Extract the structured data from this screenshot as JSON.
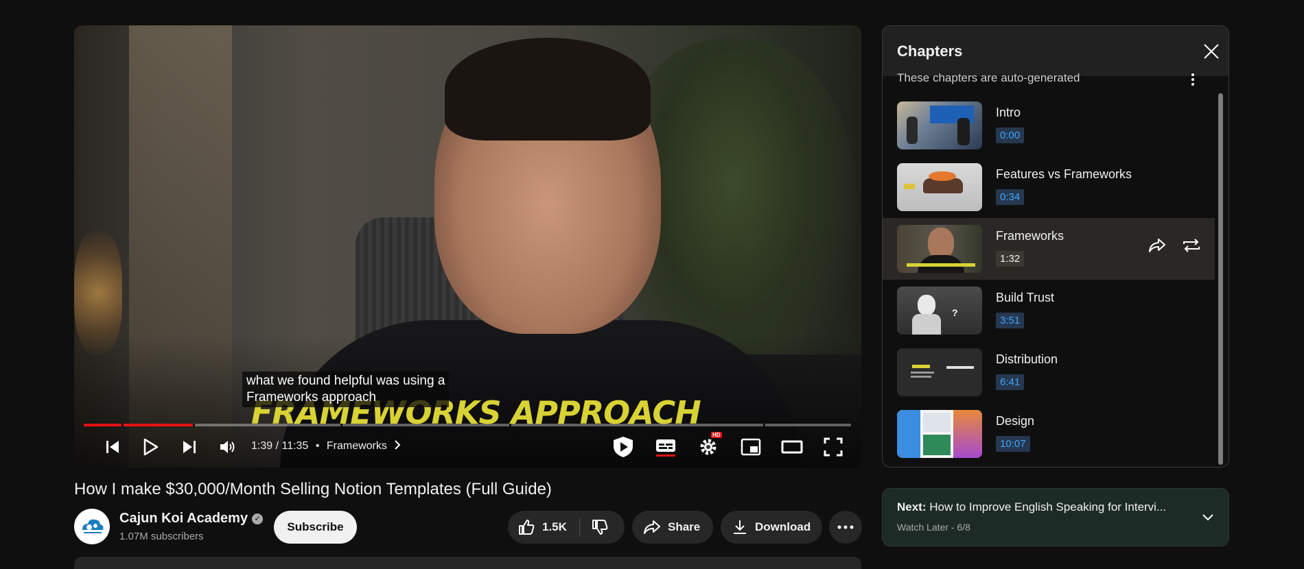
{
  "player": {
    "caption_line1": "what we found helpful was using a",
    "caption_line2": "Frameworks approach",
    "overlay_text": "FRAMEWORKS APPROACH",
    "current_time": "1:39",
    "separator": "/",
    "duration": "11:35",
    "bullet": "•",
    "chapter_label": "Frameworks",
    "progress_fraction": 0.142,
    "hd_badge": "HD",
    "icons": [
      "previous-icon",
      "play-icon",
      "next-icon",
      "volume-icon",
      "chapter-chevron-icon",
      "shield-play-icon",
      "subtitles-icon",
      "settings-icon",
      "miniplayer-icon",
      "theater-icon",
      "fullscreen-icon"
    ]
  },
  "video": {
    "title": "How I make $30,000/Month Selling Notion Templates (Full Guide)",
    "channel": "Cajun Koi Academy",
    "subscribers": "1.07M subscribers",
    "subscribe_label": "Subscribe",
    "likes": "1.5K",
    "share_label": "Share",
    "download_label": "Download"
  },
  "chapters": {
    "title": "Chapters",
    "note": "These chapters are auto-generated",
    "items": [
      {
        "label": "Intro",
        "time": "0:00"
      },
      {
        "label": "Features vs Frameworks",
        "time": "0:34"
      },
      {
        "label": "Frameworks",
        "time": "1:32",
        "active": true
      },
      {
        "label": "Build Trust",
        "time": "3:51"
      },
      {
        "label": "Distribution",
        "time": "6:41"
      },
      {
        "label": "Design",
        "time": "10:07"
      }
    ]
  },
  "next": {
    "prefix": "Next:",
    "title": "How to Improve English Speaking for Intervi...",
    "subtitle": "Watch Later - 6/8"
  },
  "colors": {
    "background": "#0f0f0f",
    "progress_red": "#e51212",
    "chapter_time_blue": "#3ea6ff",
    "overlay_yellow": "#d9d234"
  }
}
